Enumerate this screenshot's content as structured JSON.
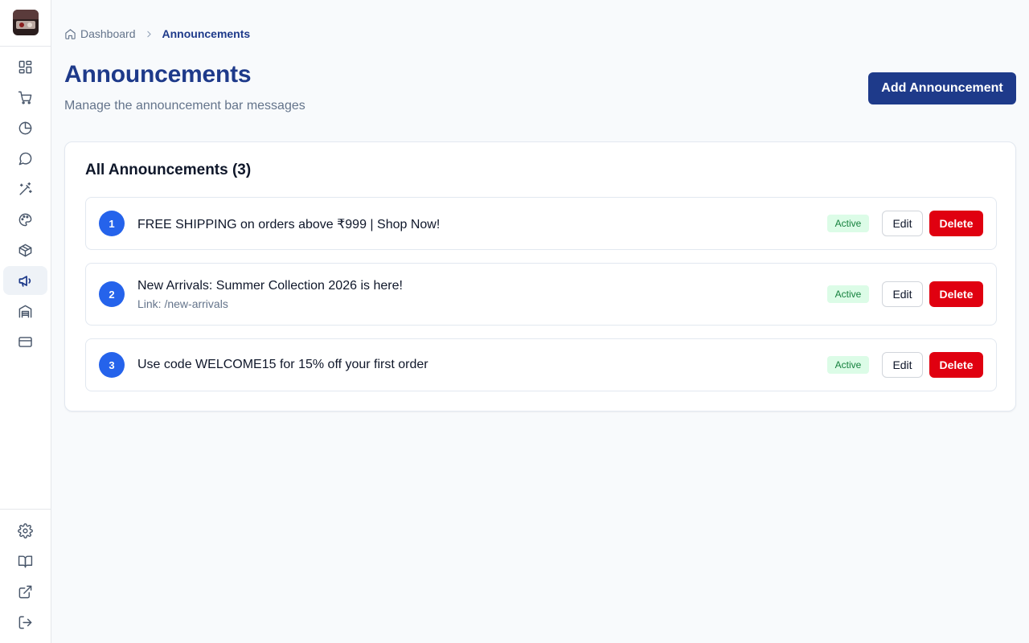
{
  "sidebar": {
    "logo_alt": "",
    "nav": [
      {
        "icon": "dashboard-grid-icon"
      },
      {
        "icon": "shopping-cart-icon"
      },
      {
        "icon": "pie-chart-icon"
      },
      {
        "icon": "message-circle-icon"
      },
      {
        "icon": "magic-wand-icon"
      },
      {
        "icon": "palette-icon"
      },
      {
        "icon": "package-icon"
      },
      {
        "icon": "megaphone-icon",
        "active": true
      },
      {
        "icon": "warehouse-icon"
      },
      {
        "icon": "credit-card-icon"
      }
    ],
    "bottom_nav": [
      {
        "icon": "gear-icon"
      },
      {
        "icon": "book-open-icon"
      },
      {
        "icon": "external-link-icon"
      },
      {
        "icon": "logout-icon"
      }
    ]
  },
  "breadcrumb": {
    "home": "Dashboard",
    "current": "Announcements"
  },
  "header": {
    "title": "Announcements",
    "subtitle": "Manage the announcement bar messages",
    "add_button": "Add Announcement"
  },
  "card": {
    "title": "All Announcements (3)"
  },
  "announcements": [
    {
      "index": "1",
      "message": "FREE SHIPPING on orders above ₹999 | Shop Now!",
      "link": "",
      "status": "Active",
      "edit": "Edit",
      "delete": "Delete"
    },
    {
      "index": "2",
      "message": "New Arrivals: Summer Collection 2026 is here!",
      "link": "Link: /new-arrivals",
      "status": "Active",
      "edit": "Edit",
      "delete": "Delete"
    },
    {
      "index": "3",
      "message": "Use code WELCOME15 for 15% off your first order",
      "link": "",
      "status": "Active",
      "edit": "Edit",
      "delete": "Delete"
    }
  ],
  "colors": {
    "primary": "#1e3a8a",
    "badge_bg": "#dcfce7",
    "badge_text": "#15803d",
    "danger": "#e00010",
    "number_circle": "#2563eb"
  }
}
